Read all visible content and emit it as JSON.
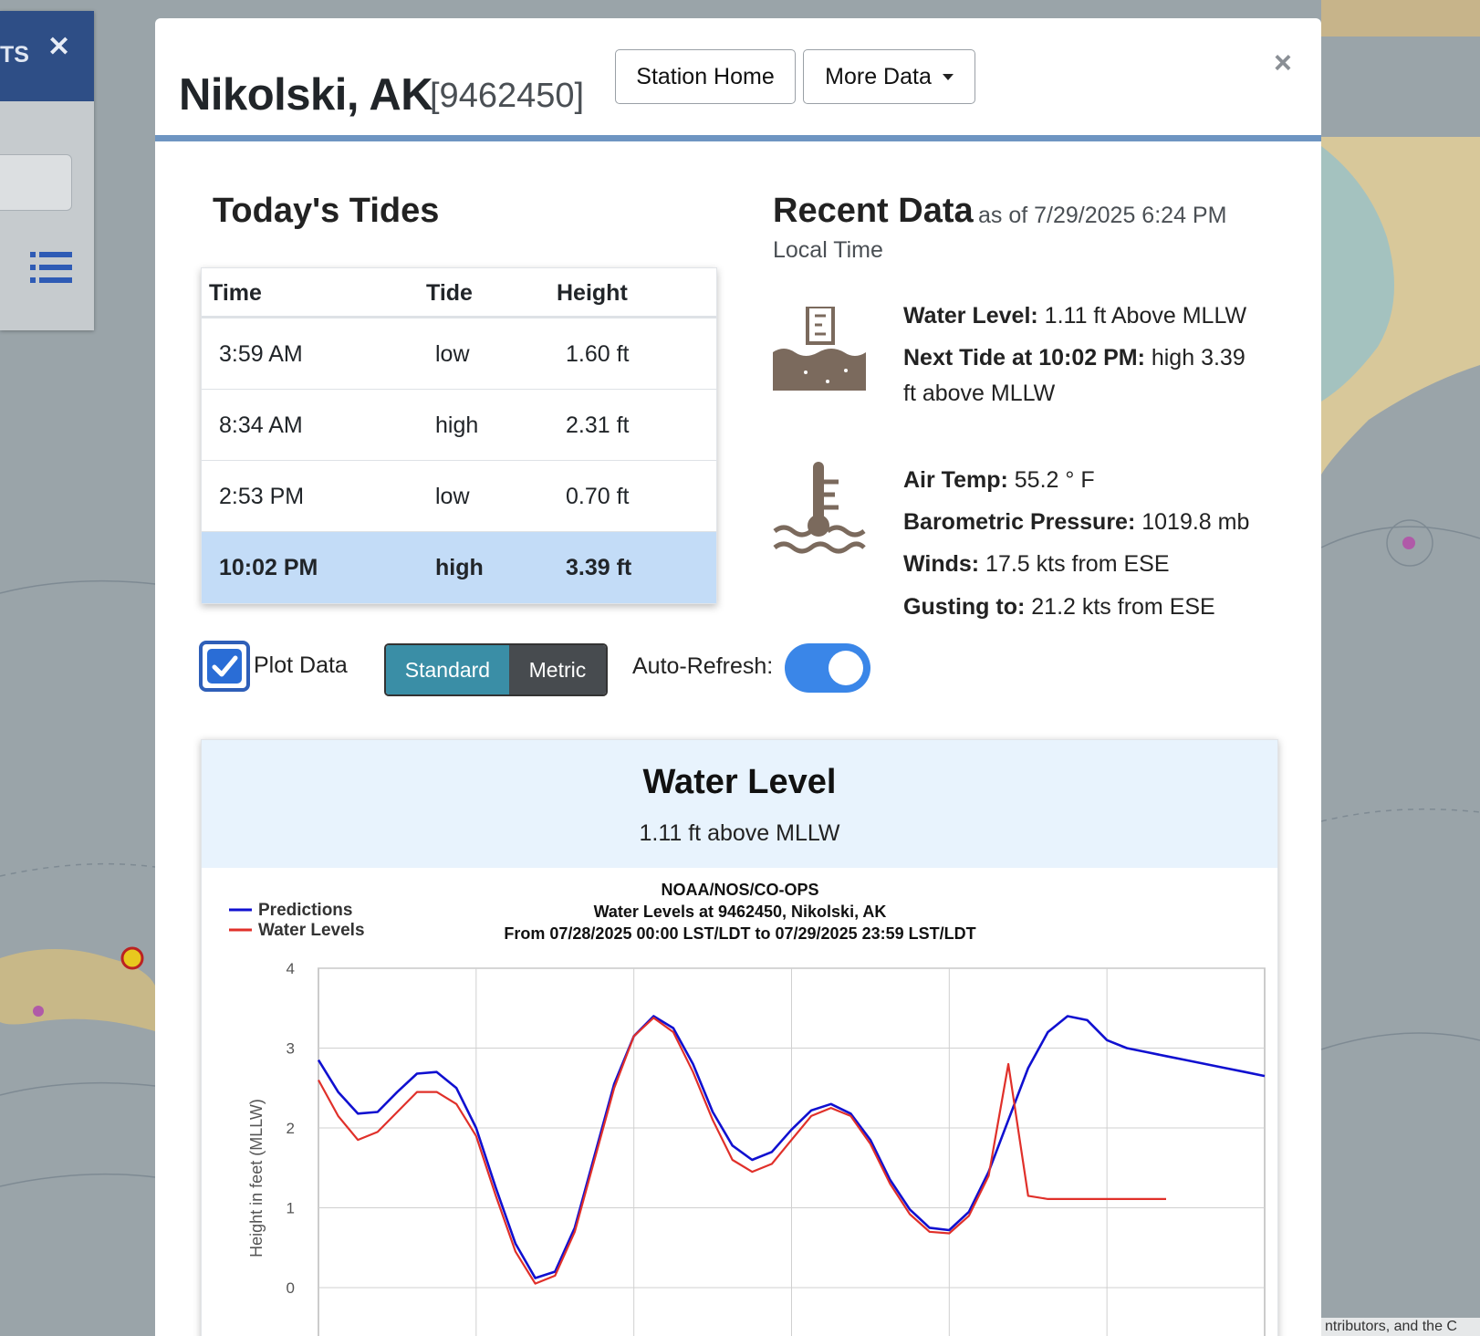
{
  "side_panel": {
    "title_fragment": "TS",
    "close_glyph": "✕"
  },
  "station": {
    "name": "Nikolski, AK",
    "id": "[9462450]",
    "station_home_label": "Station Home",
    "more_data_label": "More Data",
    "close_glyph": "×"
  },
  "tides": {
    "title": "Today's Tides",
    "headers": {
      "time": "Time",
      "tide": "Tide",
      "height": "Height"
    },
    "rows": [
      {
        "time": "3:59 AM",
        "tide": "low",
        "height": "1.60 ft"
      },
      {
        "time": "8:34 AM",
        "tide": "high",
        "height": "2.31 ft"
      },
      {
        "time": "2:53 PM",
        "tide": "low",
        "height": "0.70 ft"
      },
      {
        "time": "10:02 PM",
        "tide": "high",
        "height": "3.39 ft"
      }
    ]
  },
  "recent": {
    "title": "Recent Data",
    "as_of": "as of 7/29/2025 6:24 PM",
    "local_time": "Local Time",
    "water_level_label": "Water Level:",
    "water_level_value": " 1.11 ft Above MLLW",
    "next_tide_label": "Next Tide at 10:02 PM:",
    "next_tide_value": " high 3.39",
    "next_tide_value_2": "ft above MLLW",
    "air_temp_label": "Air Temp:",
    "air_temp_value": " 55.2 ° F",
    "pressure_label": "Barometric Pressure:",
    "pressure_value": " 1019.8 mb",
    "winds_label": "Winds:",
    "winds_value": " 17.5 kts from ESE",
    "gust_label": "Gusting to:",
    "gust_value": " 21.2 kts from ESE",
    "icons": [
      "water-level-icon",
      "air-temperature-icon"
    ]
  },
  "controls": {
    "plot_data_label": "Plot Data",
    "plot_data_checked": true,
    "standard_label": "Standard",
    "metric_label": "Metric",
    "selected_unit": "Standard",
    "auto_refresh_label": "Auto-Refresh:",
    "auto_refresh_on": true
  },
  "water_level_card": {
    "title": "Water Level",
    "subtitle": "1.11 ft above MLLW"
  },
  "attribution": "ntributors, and the C",
  "colors": {
    "accent": "#6e95c2",
    "highlight_row": "#c3dcf7",
    "predictions": "#1010d0",
    "water_levels": "#e0302a",
    "toggle": "#3a86e8"
  },
  "chart_data": {
    "type": "line",
    "title": "NOAA/NOS/CO-OPS",
    "subtitle": "Water Levels at 9462450, Nikolski, AK",
    "subtitle2": "From 07/28/2025 00:00 LST/LDT to 07/29/2025 23:59 LST/LDT",
    "ylabel": "Height in feet (MLLW)",
    "xlabel": "",
    "ylim": [
      0,
      4
    ],
    "yticks": [
      0,
      1,
      2,
      3,
      4
    ],
    "xlim": [
      0,
      48
    ],
    "x_gridlines": [
      8,
      16,
      24,
      32,
      40
    ],
    "legend": "top-left",
    "series": [
      {
        "name": "Predictions",
        "color": "#1010d0",
        "x": [
          0,
          1,
          2,
          3,
          4,
          5,
          6,
          7,
          8,
          9,
          10,
          11,
          12,
          13,
          14,
          15,
          16,
          17,
          18,
          19,
          20,
          21,
          22,
          23,
          24,
          25,
          26,
          27,
          28,
          29,
          30,
          31,
          32,
          33,
          34,
          35,
          36,
          37,
          38,
          39,
          40,
          41,
          42,
          43,
          44,
          45,
          46,
          47,
          48
        ],
        "values": [
          2.85,
          2.45,
          2.18,
          2.2,
          2.45,
          2.68,
          2.7,
          2.5,
          2.0,
          1.25,
          0.55,
          0.12,
          0.2,
          0.75,
          1.65,
          2.55,
          3.15,
          3.4,
          3.25,
          2.8,
          2.2,
          1.78,
          1.6,
          1.7,
          1.98,
          2.22,
          2.3,
          2.18,
          1.85,
          1.35,
          0.98,
          0.75,
          0.72,
          0.95,
          1.45,
          2.1,
          2.75,
          3.2,
          3.4,
          3.35,
          3.1,
          3.0,
          2.95,
          2.9,
          2.85,
          2.8,
          2.75,
          2.7,
          2.65
        ]
      },
      {
        "name": "Water Levels",
        "color": "#e0302a",
        "x": [
          0,
          1,
          2,
          3,
          4,
          5,
          6,
          7,
          8,
          9,
          10,
          11,
          12,
          13,
          14,
          15,
          16,
          17,
          18,
          19,
          20,
          21,
          22,
          23,
          24,
          25,
          26,
          27,
          28,
          29,
          30,
          31,
          32,
          33,
          34,
          35,
          36,
          37,
          38,
          39,
          40,
          41,
          42,
          43
        ],
        "values": [
          2.6,
          2.15,
          1.85,
          1.95,
          2.2,
          2.45,
          2.45,
          2.3,
          1.9,
          1.15,
          0.45,
          0.05,
          0.15,
          0.7,
          1.6,
          2.5,
          3.15,
          3.38,
          3.2,
          2.7,
          2.1,
          1.6,
          1.45,
          1.55,
          1.85,
          2.15,
          2.25,
          2.15,
          1.8,
          1.3,
          0.92,
          0.7,
          0.68,
          0.9,
          1.4,
          2.8,
          1.15,
          1.11,
          1.11,
          1.11,
          1.11,
          1.11,
          1.11,
          1.11
        ]
      }
    ]
  }
}
